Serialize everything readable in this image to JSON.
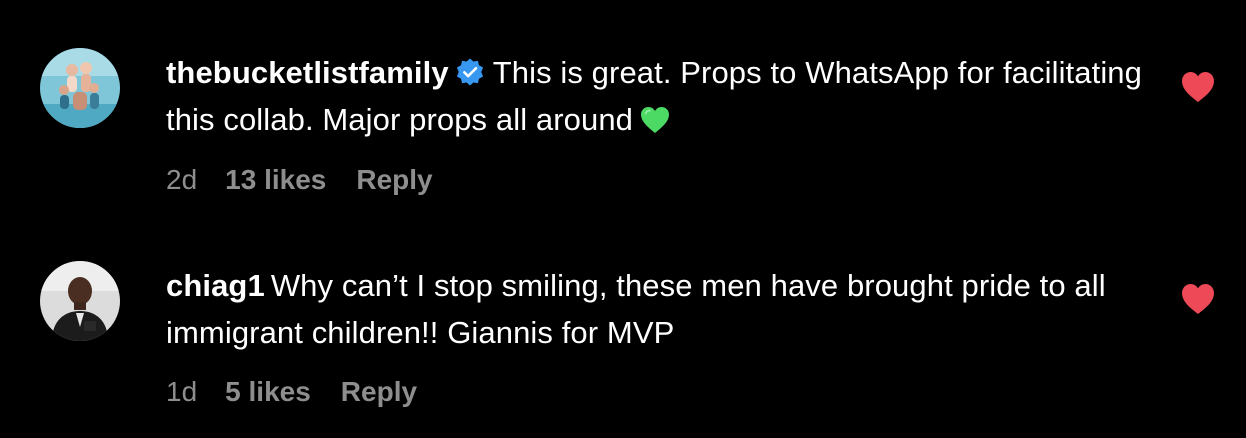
{
  "comments": [
    {
      "username": "thebucketlistfamily",
      "verified": true,
      "text": "This is great. Props to WhatsApp for facilitating this collab. Major props all around",
      "emoji": "green-heart",
      "time": "2d",
      "likes": "13 likes",
      "reply": "Reply",
      "liked": true
    },
    {
      "username": "chiag1",
      "verified": false,
      "text": "Why can’t I stop smiling, these men have brought pride to all immigrant children!! Giannis for MVP",
      "time": "1d",
      "likes": "5 likes",
      "reply": "Reply",
      "liked": true
    }
  ],
  "colors": {
    "background": "#000000",
    "text": "#ffffff",
    "meta": "#8e8e8e",
    "like_heart": "#ed4956",
    "verified_badge": "#3897f0",
    "green_heart_emoji": "#4cd964"
  },
  "icons": {
    "like": "heart-icon",
    "verified": "verified-badge-icon",
    "emoji": "green-heart-emoji-icon"
  }
}
